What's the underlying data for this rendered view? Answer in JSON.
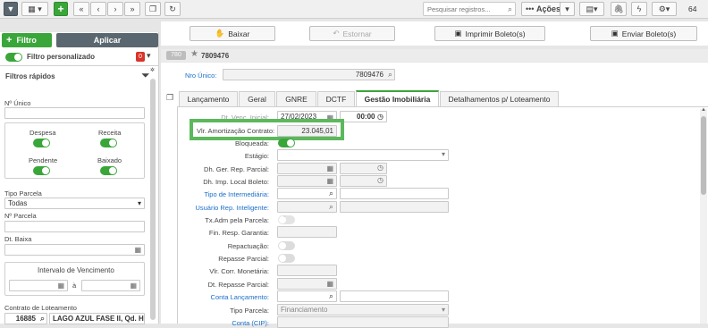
{
  "toolbar": {
    "search_placeholder": "Pesquisar registros...",
    "actions_label": "Ações",
    "page_number": "64"
  },
  "filter_panel": {
    "filter_label": "Filtro",
    "apply_label": "Aplicar",
    "custom_filter_label": "Filtro personalizado",
    "custom_filter_badge": "0",
    "quick_filters_label": "Filtros rápidos",
    "nro_unico_label": "Nº Único",
    "despesa_label": "Despesa",
    "receita_label": "Receita",
    "pendente_label": "Pendente",
    "baixado_label": "Baixado",
    "tipo_parcela_label": "Tipo Parcela",
    "tipo_parcela_value": "Todas",
    "nro_parcela_label": "Nº Parcela",
    "dt_baixa_label": "Dt. Baixa",
    "intervalo_label": "Intervalo de Vencimento",
    "intervalo_sep": "à",
    "contrato_label": "Contrato de Loteamento",
    "contrato_value": "16885",
    "contrato_desc": "LAGO AZUL FASE II, Qd. H"
  },
  "actions": {
    "baixar": "Baixar",
    "estornar": "Estornar",
    "imprimir": "Imprimir Boleto(s)",
    "enviar": "Enviar Boleto(s)"
  },
  "record": {
    "badge": "780",
    "star_number": "7809476",
    "nro_unico_label": "Nro Único:",
    "nro_unico_value": "7809476"
  },
  "tabs": [
    "Lançamento",
    "Geral",
    "GNRE",
    "DCTF",
    "Gestão Imobiliária",
    "Detalhamentos p/ Loteamento"
  ],
  "form": {
    "dt_partial_label": "Dt. Venc. Inicial:",
    "dt_partial_value": "27/02/2023",
    "time_value": "00:00",
    "amortizacao_label": "Vlr. Amortização Contrato:",
    "amortizacao_value": "23.045,01",
    "bloqueada_label": "Bloqueada:",
    "estagio_label": "Estágio:",
    "dh_ger_label": "Dh. Ger. Rep. Parcial:",
    "dh_imp_label": "Dh. Imp. Local Boleto:",
    "tipo_intermediaria_label": "Tipo de Intermediária:",
    "usuario_rep_label": "Usuário Rep. Inteligente:",
    "tx_adm_label": "Tx.Adm pela Parcela:",
    "fin_resp_label": "Fin. Resp. Garantia:",
    "repactuacao_label": "Repactuação:",
    "repasse_label": "Repasse Parcial:",
    "vlr_corr_label": "Vlr. Corr. Monetária:",
    "dt_repasse_label": "Dt. Repasse Parcial:",
    "conta_lancamento_label": "Conta Lançamento:",
    "tipo_parcela_label": "Tipo Parcela:",
    "tipo_parcela_value": "Financiamento",
    "conta_cip_label": "Conta (CIP):"
  },
  "colors": {
    "accent": "#3aa63a",
    "link": "#1a6fc9"
  }
}
